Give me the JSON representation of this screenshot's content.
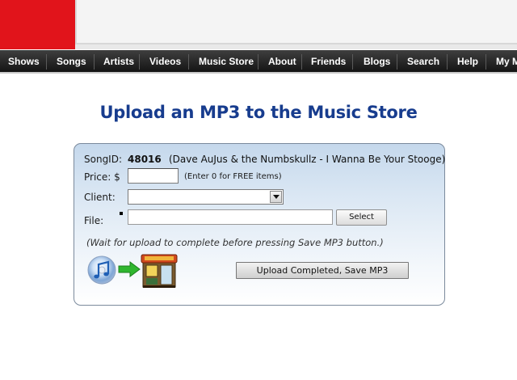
{
  "nav": {
    "items": [
      {
        "label": "Shows"
      },
      {
        "label": "Songs"
      },
      {
        "label": "Artists"
      },
      {
        "label": "Videos"
      },
      {
        "label": "Music Store"
      },
      {
        "label": "About"
      },
      {
        "label": "Friends"
      },
      {
        "label": "Blogs"
      },
      {
        "label": "Search"
      },
      {
        "label": "Help"
      },
      {
        "label": "My M"
      }
    ]
  },
  "page": {
    "title": "Upload an MP3 to the Music Store"
  },
  "form": {
    "songid_label": "SongID:",
    "songid_value": "48016",
    "song_name": "(Dave AuJus & the Numbskullz - I Wanna Be Your Stooge)",
    "price_label": "Price: $",
    "price_value": "",
    "price_hint": "(Enter 0 for FREE items)",
    "client_label": "Client:",
    "client_value": "",
    "file_label": "File:",
    "file_value": "",
    "select_button": "Select",
    "wait_note": "(Wait for upload to complete before pressing Save MP3 button.)",
    "save_button": "Upload Completed, Save MP3"
  },
  "colors": {
    "banner_red": "#e1141b",
    "nav_bg": "#1c1c1c",
    "title_blue": "#173c8e",
    "panel_blue": "#c5d8ec"
  },
  "icons": [
    "music-disc-icon",
    "green-arrow-icon",
    "music-store-icon",
    "chevron-down-icon"
  ]
}
